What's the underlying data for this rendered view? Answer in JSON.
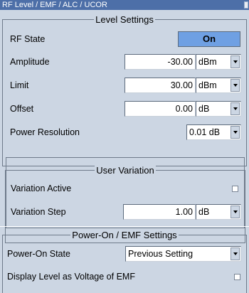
{
  "window": {
    "title": "RF Level / EMF / ALC / UCOR"
  },
  "level_settings": {
    "title": "Level Settings",
    "rf_state": {
      "label": "RF State",
      "value": "On"
    },
    "amplitude": {
      "label": "Amplitude",
      "value": "-30.00",
      "unit": "dBm"
    },
    "limit": {
      "label": "Limit",
      "value": "30.00",
      "unit": "dBm"
    },
    "offset": {
      "label": "Offset",
      "value": "0.00",
      "unit": "dB"
    },
    "power_resolution": {
      "label": "Power Resolution",
      "value": "0.01 dB"
    }
  },
  "user_variation": {
    "title": "User Variation",
    "variation_active": {
      "label": "Variation Active",
      "checked": false
    },
    "variation_step": {
      "label": "Variation Step",
      "value": "1.00",
      "unit": "dB"
    }
  },
  "power_on": {
    "title": "Power-On / EMF Settings",
    "power_on_state": {
      "label": "Power-On State",
      "value": "Previous Setting"
    },
    "display_level_emf": {
      "label": "Display Level as Voltage of EMF",
      "checked": false
    }
  }
}
